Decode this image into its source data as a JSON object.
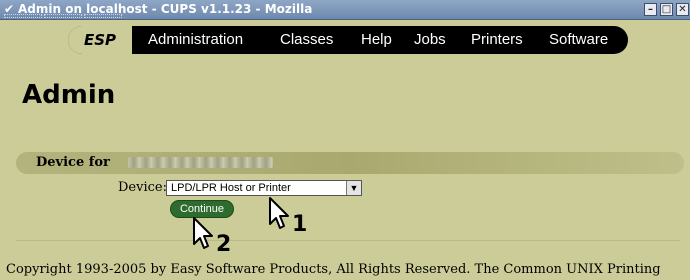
{
  "window": {
    "title": "Admin on localhost - CUPS v1.1.23 - Mozilla",
    "menu_icon": "checkmark-menu-icon",
    "controls": [
      "minimize-icon",
      "maximize-icon",
      "close-icon"
    ]
  },
  "nav": {
    "items": [
      "ESP",
      "Administration",
      "Classes",
      "Help",
      "Jobs",
      "Printers",
      "Software"
    ]
  },
  "page": {
    "heading": "Admin",
    "device_for_label": "Device for",
    "device_label": "Device:",
    "device_value": "LPD/LPR Host or Printer",
    "continue_label": "Continue",
    "footer": "Copyright 1993-2005 by Easy Software Products, All Rights Reserved. The Common UNIX Printing"
  },
  "annotations": {
    "step1": "1",
    "step2": "2"
  },
  "colors": {
    "page_background": "#cccc99",
    "nav_background": "#000000",
    "continue_button": "#2e6b2e",
    "titlebar": "#7f98bc"
  }
}
